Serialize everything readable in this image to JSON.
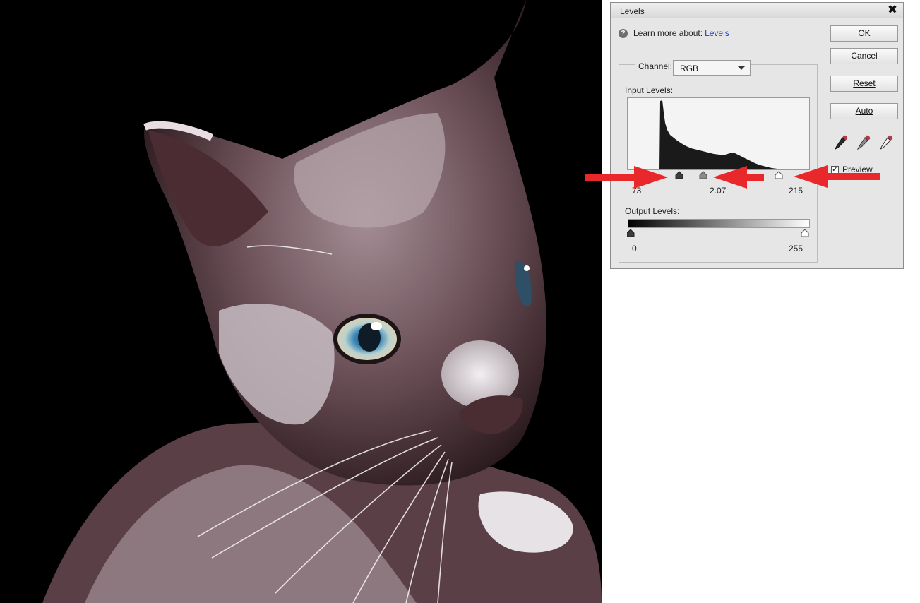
{
  "dialog": {
    "title": "Levels",
    "close_glyph": "✖",
    "help": {
      "icon": "help-icon",
      "glyph": "?",
      "text": "Learn more about:",
      "link": "Levels"
    },
    "channel": {
      "label": "Channel:",
      "value": "RGB"
    },
    "input_levels": {
      "label": "Input Levels:",
      "black": "73",
      "gamma": "2.07",
      "white": "215"
    },
    "output_levels": {
      "label": "Output Levels:",
      "black": "0",
      "white": "255"
    },
    "buttons": {
      "ok": "OK",
      "cancel": "Cancel",
      "reset": "Reset",
      "auto": "Auto"
    },
    "eyedroppers": [
      "black-eyedropper-icon",
      "gray-eyedropper-icon",
      "white-eyedropper-icon"
    ],
    "preview": {
      "label": "Preview",
      "checked": true,
      "check_glyph": "✓"
    }
  },
  "colors": {
    "annotation_arrow": "#e8282b",
    "link": "#1a3fc8",
    "dialog_bg": "#e6e6e6"
  }
}
